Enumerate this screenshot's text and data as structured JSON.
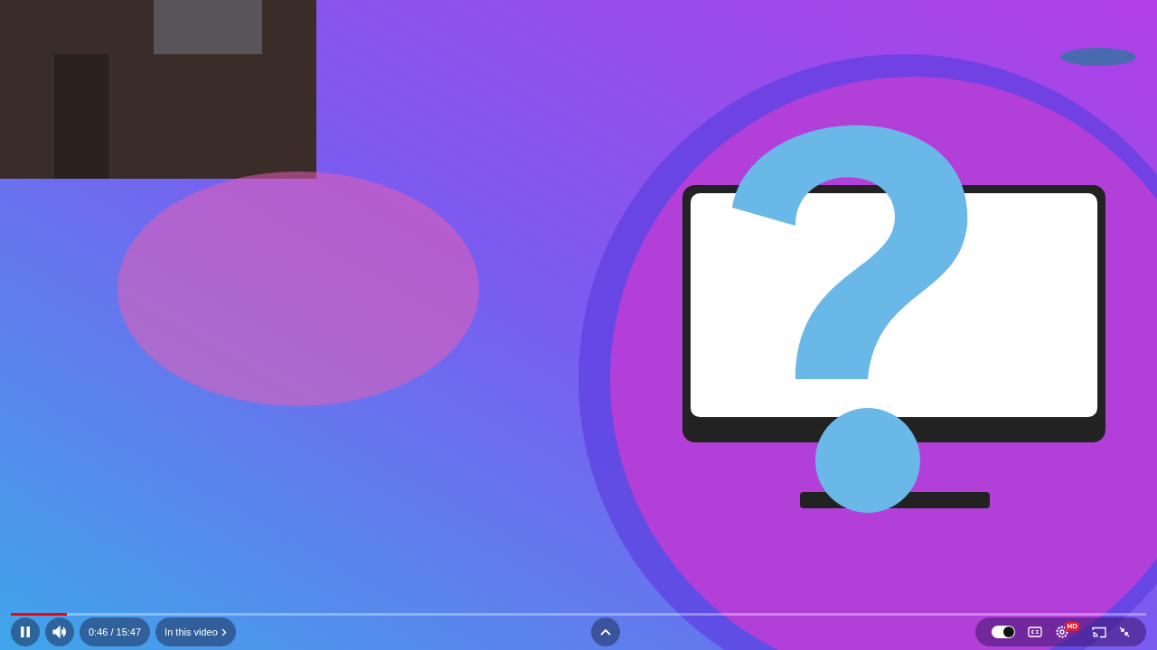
{
  "player": {
    "progress": {
      "level": 0.049
    },
    "time": "0:46 / 15:47",
    "chapter_button": "In this video",
    "autoplay": {
      "on": true
    },
    "settings": {
      "badge": "HD"
    }
  }
}
